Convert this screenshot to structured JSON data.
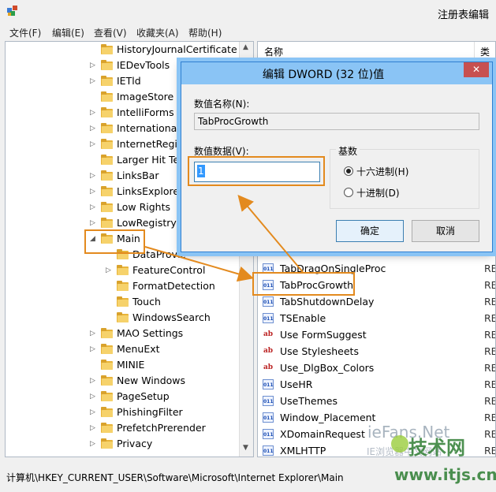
{
  "window": {
    "title": "注册表编辑"
  },
  "menu": [
    "文件(F)",
    "编辑(E)",
    "查看(V)",
    "收藏夹(A)",
    "帮助(H)"
  ],
  "tree": [
    {
      "label": "HistoryJournalCertificate",
      "expander": "none"
    },
    {
      "label": "IEDevTools",
      "expander": "collapsed"
    },
    {
      "label": "IETld",
      "expander": "collapsed"
    },
    {
      "label": "ImageStore",
      "expander": "none"
    },
    {
      "label": "IntelliForms",
      "expander": "collapsed"
    },
    {
      "label": "International",
      "expander": "collapsed"
    },
    {
      "label": "InternetRegist",
      "expander": "collapsed"
    },
    {
      "label": "Larger Hit Tes",
      "expander": "none"
    },
    {
      "label": "LinksBar",
      "expander": "collapsed"
    },
    {
      "label": "LinksExplorer",
      "expander": "collapsed"
    },
    {
      "label": "Low Rights",
      "expander": "collapsed"
    },
    {
      "label": "LowRegistry",
      "expander": "collapsed"
    },
    {
      "label": "Main",
      "expander": "expanded"
    },
    {
      "label": "DataProvic",
      "expander": "none",
      "child": true
    },
    {
      "label": "FeatureControl",
      "expander": "collapsed",
      "child": true
    },
    {
      "label": "FormatDetection",
      "expander": "none",
      "child": true
    },
    {
      "label": "Touch",
      "expander": "none",
      "child": true
    },
    {
      "label": "WindowsSearch",
      "expander": "none",
      "child": true
    },
    {
      "label": "MAO Settings",
      "expander": "collapsed"
    },
    {
      "label": "MenuExt",
      "expander": "collapsed"
    },
    {
      "label": "MINIE",
      "expander": "none"
    },
    {
      "label": "New Windows",
      "expander": "collapsed"
    },
    {
      "label": "PageSetup",
      "expander": "collapsed"
    },
    {
      "label": "PhishingFilter",
      "expander": "collapsed"
    },
    {
      "label": "PrefetchPrerender",
      "expander": "collapsed"
    },
    {
      "label": "Privacy",
      "expander": "collapsed"
    }
  ],
  "list": {
    "header_name": "名称",
    "header_type": "类型",
    "rows": [
      {
        "name": "TabDragOnSingleProc",
        "kind": "binary",
        "type": "REG"
      },
      {
        "name": "TabProcGrowth",
        "kind": "binary",
        "type": "REG"
      },
      {
        "name": "TabShutdownDelay",
        "kind": "binary",
        "type": "REG"
      },
      {
        "name": "TSEnable",
        "kind": "binary",
        "type": "REG"
      },
      {
        "name": "Use FormSuggest",
        "kind": "string",
        "type": "REG"
      },
      {
        "name": "Use Stylesheets",
        "kind": "string",
        "type": "REG"
      },
      {
        "name": "Use_DlgBox_Colors",
        "kind": "string",
        "type": "REG"
      },
      {
        "name": "UseHR",
        "kind": "binary",
        "type": "REG"
      },
      {
        "name": "UseThemes",
        "kind": "binary",
        "type": "REG"
      },
      {
        "name": "Window_Placement",
        "kind": "binary",
        "type": "REG"
      },
      {
        "name": "XDomainRequest",
        "kind": "binary",
        "type": "REG"
      },
      {
        "name": "XMLHTTP",
        "kind": "binary",
        "type": "REG"
      }
    ]
  },
  "status": {
    "path": "计算机\\HKEY_CURRENT_USER\\Software\\Microsoft\\Internet Explorer\\Main"
  },
  "dialog": {
    "title": "编辑 DWORD (32 位)值",
    "close_glyph": "✕",
    "name_label": "数值名称(N):",
    "name_value": "TabProcGrowth",
    "data_label": "数值数据(V):",
    "data_value": "1",
    "base_label": "基数",
    "hex_label": "十六进制(H)",
    "dec_label": "十进制(D)",
    "selected_base": "hex",
    "ok_label": "确定",
    "cancel_label": "取消"
  },
  "watermark": {
    "line1": "ieFans.Net",
    "line2": "IE浏览器中文网站",
    "brand": "技术网",
    "url": "www.itjs.cn"
  },
  "colors": {
    "highlight": "#e38a1e",
    "dialog_frame": "#8ac4f5",
    "close_button": "#c75050",
    "selection": "#3399ff"
  }
}
